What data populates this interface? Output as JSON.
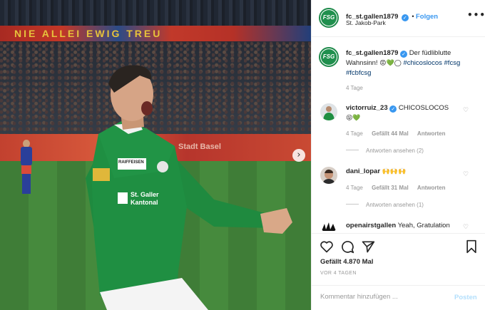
{
  "account": {
    "username": "fc_st.gallen1879",
    "avatar_text": "FSG",
    "location": "St. Jakob-Park",
    "follow_label": "Folgen",
    "more_label": "•••"
  },
  "photo": {
    "banner_text": "NIE ALLEI  EWIG TREU",
    "ad_text": "Stadt Basel",
    "jersey": {
      "sponsor_top": "RAIFFEISEN",
      "sponsor_chest_1": "St. Galler",
      "sponsor_chest_2": "Kantonal"
    },
    "next_label": "›"
  },
  "caption": {
    "username": "fc_st.gallen1879",
    "text": "Der füdliblutte Wahnsinn!",
    "emojis": "😡💚◯",
    "hashtag1": "#chicoslocos",
    "hashtag2": "#fcsg",
    "hashtag3": "#fcbfcsg",
    "time": "4 Tage"
  },
  "comments": [
    {
      "username": "victorruiz_23",
      "text": "CHICOSLOCOS",
      "emojis": "😜💚",
      "time": "4 Tage",
      "likes": "Gefällt 44 Mal",
      "reply_label": "Antworten",
      "view_replies": "Antworten ansehen (2)"
    },
    {
      "username": "dani_lopar",
      "text": "",
      "emojis": "🙌🙌🙌",
      "time": "4 Tage",
      "likes": "Gefällt 31 Mal",
      "reply_label": "Antworten",
      "view_replies": "Antworten ansehen (1)"
    },
    {
      "username": "openairstgallen",
      "text": "Yeah, Gratulation"
    }
  ],
  "actions": {
    "likes": "Gefällt 4.870 Mal",
    "posted_ago": "VOR 4 TAGEN",
    "comment_placeholder": "Kommentar hinzufügen ...",
    "post_label": "Posten"
  },
  "colors": {
    "accent": "#3897f0",
    "club_green": "#1f8f4d"
  }
}
